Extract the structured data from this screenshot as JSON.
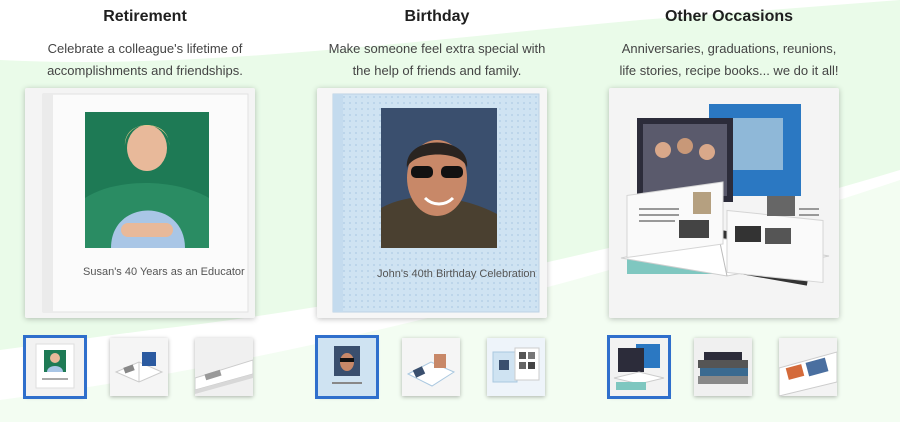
{
  "colors": {
    "accent": "#2f6fcc",
    "background_wave": "#eafbe9"
  },
  "columns": [
    {
      "title": "Retirement",
      "description_line1": "Celebrate a colleague's lifetime of",
      "description_line2": "accomplishments and friendships.",
      "book_caption": "Susan's 40 Years as an Educator",
      "selected_thumbnail": 1
    },
    {
      "title": "Birthday",
      "description_line1": "Make someone feel extra special with",
      "description_line2": "the help of friends and family.",
      "book_caption": "John's 40th Birthday Celebration",
      "selected_thumbnail": 1
    },
    {
      "title": "Other Occasions",
      "description_line1": "Anniversaries, graduations, reunions,",
      "description_line2": "life stories, recipe books... we do it all!",
      "selected_thumbnail": 1
    }
  ]
}
